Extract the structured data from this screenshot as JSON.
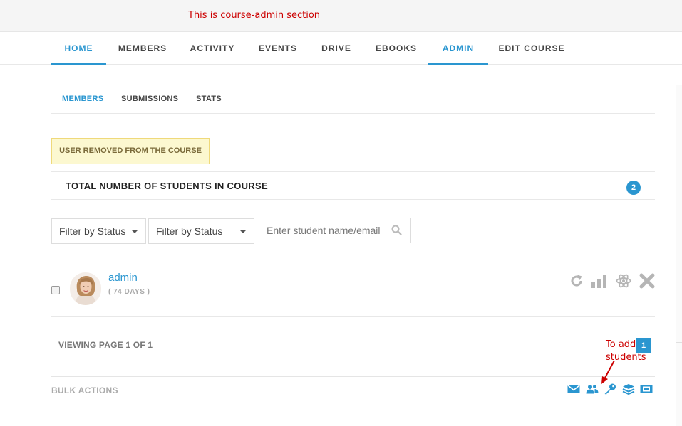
{
  "annotations": {
    "top": "This is course-admin section",
    "add_students": "To add students"
  },
  "main_nav": {
    "tabs": [
      {
        "label": "HOME",
        "active": true
      },
      {
        "label": "MEMBERS",
        "active": false
      },
      {
        "label": "ACTIVITY",
        "active": false
      },
      {
        "label": "EVENTS",
        "active": false
      },
      {
        "label": "DRIVE",
        "active": false
      },
      {
        "label": "EBOOKS",
        "active": false
      },
      {
        "label": "ADMIN",
        "active": true
      },
      {
        "label": "EDIT COURSE",
        "active": false
      }
    ]
  },
  "sub_nav": {
    "tabs": [
      {
        "label": "MEMBERS",
        "active": true
      },
      {
        "label": "SUBMISSIONS",
        "active": false
      },
      {
        "label": "STATS",
        "active": false
      }
    ]
  },
  "notice": "USER REMOVED FROM THE COURSE",
  "total": {
    "label": "TOTAL NUMBER OF STUDENTS IN COURSE",
    "count": "2"
  },
  "filters": {
    "status_1": "Filter by Status",
    "status_2": "Filter by Status",
    "search_placeholder": "Enter student name/email"
  },
  "member": {
    "name": "admin",
    "days": "( 74 DAYS )",
    "actions": [
      "refresh-icon",
      "stats-bars-icon",
      "atom-icon",
      "remove-icon"
    ]
  },
  "pagination": {
    "viewing": "VIEWING PAGE 1 OF 1",
    "page": "1"
  },
  "bulk": {
    "label": "BULK ACTIONS",
    "icons": [
      "envelope-icon",
      "add-users-icon",
      "key-icon",
      "layers-icon",
      "certificate-icon"
    ]
  },
  "colors": {
    "accent": "#2a96d0",
    "annotation": "#cc0000",
    "notice_bg": "#fcf8d0"
  }
}
